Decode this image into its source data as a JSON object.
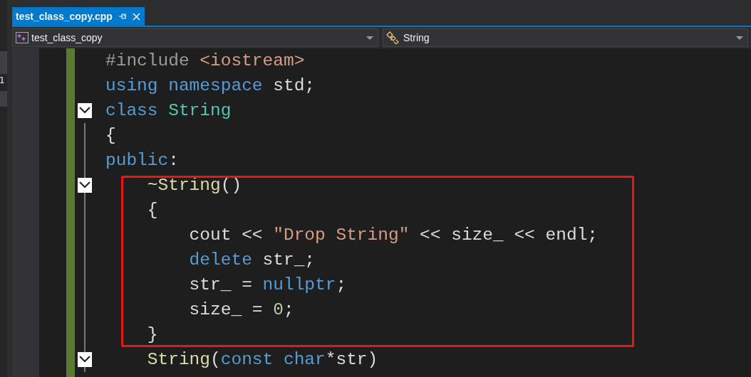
{
  "side_panel": {
    "text": "1"
  },
  "tabs": [
    {
      "label": "test_class_copy.cpp",
      "selected": true
    }
  ],
  "navigation": {
    "project": "test_class_copy",
    "member": "String"
  },
  "lines": [
    {
      "kind": "line",
      "collapsible": false,
      "tokens": [
        {
          "text": "#include ",
          "kind": "preprocessor"
        },
        {
          "text": "<iostream>",
          "kind": "string"
        }
      ]
    },
    {
      "kind": "line",
      "collapsible": false,
      "tokens": [
        {
          "text": "using namespace",
          "kind": "keyword"
        },
        {
          "text": " std;",
          "kind": "plain"
        }
      ]
    },
    {
      "kind": "line",
      "collapsible": true,
      "tokens": [
        {
          "text": "class ",
          "kind": "keyword"
        },
        {
          "text": "String",
          "kind": "type"
        }
      ]
    },
    {
      "kind": "line",
      "collapsible": false,
      "tokens": [
        {
          "text": "{",
          "kind": "plain"
        }
      ]
    },
    {
      "kind": "line",
      "collapsible": false,
      "tokens": [
        {
          "text": "public",
          "kind": "keyword"
        },
        {
          "text": ":",
          "kind": "plain"
        }
      ]
    },
    {
      "kind": "highlight",
      "children": [
        {
          "kind": "line",
          "collapsible": true,
          "tokens": [
            {
              "text": "    ~String",
              "kind": "function"
            },
            {
              "text": "()",
              "kind": "plain"
            }
          ]
        },
        {
          "kind": "line",
          "collapsible": false,
          "tokens": [
            {
              "text": "    {",
              "kind": "plain"
            }
          ]
        },
        {
          "kind": "line",
          "collapsible": false,
          "tokens": [
            {
              "text": "        cout << ",
              "kind": "plain"
            },
            {
              "text": "\"Drop String\"",
              "kind": "string"
            },
            {
              "text": " << size_ << endl;",
              "kind": "plain"
            }
          ]
        },
        {
          "kind": "line",
          "collapsible": false,
          "tokens": [
            {
              "text": "        delete",
              "kind": "keyword"
            },
            {
              "text": " str_;",
              "kind": "plain"
            }
          ]
        },
        {
          "kind": "line",
          "collapsible": false,
          "tokens": [
            {
              "text": "        str_ = ",
              "kind": "plain"
            },
            {
              "text": "nullptr",
              "kind": "keyword"
            },
            {
              "text": ";",
              "kind": "plain"
            }
          ]
        },
        {
          "kind": "line",
          "collapsible": false,
          "tokens": [
            {
              "text": "        size_ = ",
              "kind": "plain"
            },
            {
              "text": "0",
              "kind": "number"
            },
            {
              "text": ";",
              "kind": "plain"
            }
          ]
        },
        {
          "kind": "line",
          "collapsible": false,
          "tokens": [
            {
              "text": "    }",
              "kind": "plain"
            }
          ]
        }
      ]
    },
    {
      "kind": "line",
      "collapsible": true,
      "tokens": [
        {
          "text": "    String",
          "kind": "function"
        },
        {
          "text": "(",
          "kind": "plain"
        },
        {
          "text": "const char",
          "kind": "keyword"
        },
        {
          "text": "*str)",
          "kind": "plain"
        }
      ]
    }
  ]
}
